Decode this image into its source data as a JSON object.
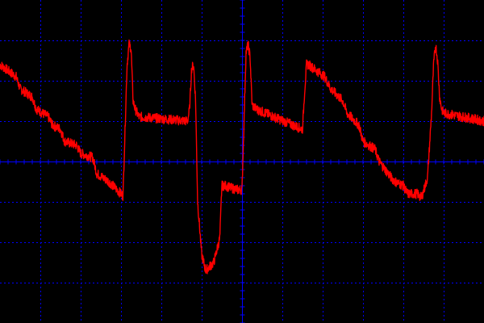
{
  "colors": {
    "background": "#000000",
    "grid": "#0000ff",
    "trace": "#ff0000"
  },
  "chart_data": {
    "type": "line",
    "grid": true,
    "title": "",
    "xlabel": "",
    "ylabel": "",
    "xlim": [
      0,
      12
    ],
    "ylim": [
      -4,
      4
    ],
    "x_divisions": 12,
    "y_divisions": 8,
    "series": [
      {
        "name": "",
        "color": "#ff0000",
        "noise": 0.12,
        "x": [
          0,
          0.4,
          0.5,
          0.8,
          0.9,
          1.2,
          1.3,
          1.5,
          1.6,
          1.9,
          2.0,
          2.3,
          2.4,
          2.7,
          2.75,
          3.0,
          3.05,
          3.15,
          3.2,
          3.25,
          3.3,
          3.35,
          3.4,
          3.45,
          3.55,
          4.65,
          4.7,
          4.75,
          4.8,
          4.85,
          4.9,
          5.0,
          5.1,
          5.3,
          5.4,
          5.45,
          5.5,
          5.6,
          5.7,
          5.9,
          6.0,
          6.1,
          6.15,
          6.2,
          6.25,
          6.35,
          6.8,
          7.5,
          7.55,
          7.6,
          7.65,
          8.05,
          8.2,
          8.5,
          8.6,
          8.9,
          9.0,
          9.3,
          9.4,
          9.7,
          9.8,
          10.0,
          10.1,
          10.35,
          10.45,
          10.6,
          10.7,
          10.75,
          10.8,
          10.85,
          10.9,
          10.95,
          11.0,
          12.0
        ],
        "y": [
          2.4,
          2.1,
          1.8,
          1.6,
          1.3,
          1.1,
          0.9,
          0.8,
          0.5,
          0.4,
          0.2,
          0.1,
          -0.3,
          -0.5,
          -0.55,
          -0.8,
          -0.85,
          2.4,
          2.9,
          2.8,
          1.5,
          1.3,
          1.2,
          1.1,
          1.1,
          1.0,
          1.3,
          2.3,
          2.4,
          1.5,
          -1.0,
          -2.3,
          -2.7,
          -2.5,
          -2.1,
          -1.9,
          -0.6,
          -0.6,
          -0.65,
          -0.7,
          -0.7,
          2.7,
          2.9,
          2.6,
          1.4,
          1.3,
          1.1,
          0.8,
          1.7,
          2.4,
          2.4,
          2.1,
          1.8,
          1.5,
          1.2,
          0.9,
          0.5,
          0.3,
          0.0,
          -0.4,
          -0.5,
          -0.6,
          -0.8,
          -0.8,
          -0.9,
          -0.4,
          1.2,
          2.4,
          2.9,
          2.5,
          1.6,
          1.3,
          1.2,
          1.0
        ]
      }
    ]
  }
}
